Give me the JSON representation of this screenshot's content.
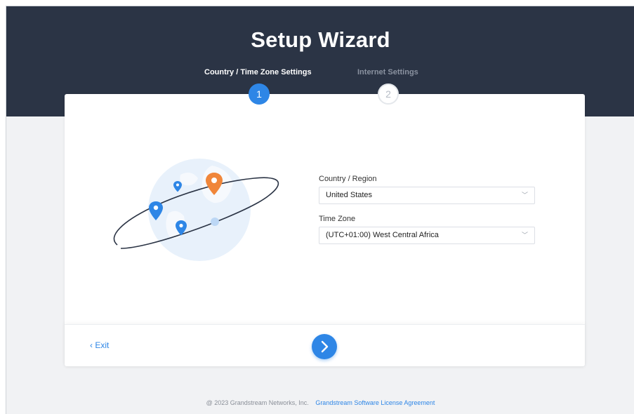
{
  "header": {
    "title": "Setup Wizard"
  },
  "steps": [
    {
      "label": "Country / Time Zone Settings",
      "number": "1",
      "state": "active"
    },
    {
      "label": "Internet Settings",
      "number": "2",
      "state": "inactive"
    }
  ],
  "form": {
    "country": {
      "label": "Country / Region",
      "value": "United States"
    },
    "timezone": {
      "label": "Time Zone",
      "value": "(UTC+01:00) West Central Africa"
    }
  },
  "footer": {
    "exit_label": "Exit",
    "next_icon": "chevron-right-icon"
  },
  "copyright": {
    "text": "@ 2023 Grandstream Networks, Inc.",
    "link": "Grandstream Software License Agreement"
  },
  "colors": {
    "header_bg": "#2b3445",
    "accent": "#2e86e6",
    "pin_orange": "#f0863a",
    "page_bg": "#f1f2f4"
  }
}
